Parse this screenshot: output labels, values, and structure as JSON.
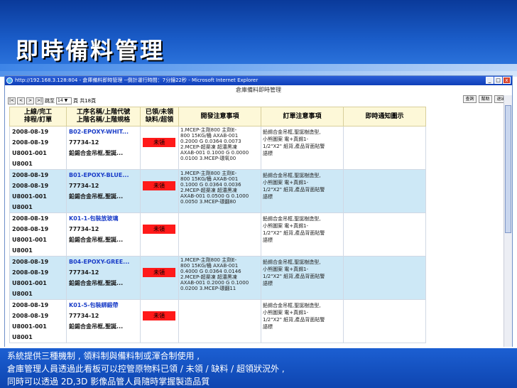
{
  "slide": {
    "title": "即時備料管理",
    "caption": [
      "系統提供三種機制 , 領料制與備料制或渾合制使用 ,",
      "倉庫管理人員透過此看板可以控管原物料已領 / 未領 / 缺料 / 超領狀況外 ,",
      "同時可以透過 2D,3D 影像品管人員隨時掌握製造品質"
    ]
  },
  "window": {
    "title": "http://192.168.3.128:804 - 倉庫備料即時管理 --倒計運行時間：7分鐘22秒 - Microsoft Internet Explorer",
    "page_heading": "倉庫備料即時管理",
    "controls": {
      "minimize": "_",
      "maximize": "□",
      "close": "x"
    }
  },
  "pager": {
    "first": "|<",
    "prev": "<",
    "next": ">",
    "last": ">|",
    "goto_label": "跳至",
    "page_value": "14",
    "dropdown": "▼",
    "total": "頁 共18頁"
  },
  "actions": {
    "query": "查詢",
    "help": "幫助",
    "exit": "退出"
  },
  "table": {
    "headers": {
      "col1": [
        "上線/完工",
        "排程/訂單"
      ],
      "col2": [
        "工序名稱/上階代號",
        "上階名稱/上階規格"
      ],
      "col3": [
        "已領/未領",
        "缺料/超領"
      ],
      "col4": "開發注意事項",
      "col5": "訂單注意事項",
      "col6": "即時通知圖示"
    },
    "rows": [
      {
        "style": "white",
        "col1": [
          "2008-08-19",
          "2008-08-19",
          "U8001-001",
          "U8001"
        ],
        "process": "B02-EPOXY-WHIT...",
        "process_link": true,
        "col2": [
          "77734-12",
          "鉛錫合金吊框,聖誕..."
        ],
        "status": "未領",
        "notes": [
          "1.MCEP-主劑800 主劑E-",
          "800 15KG/桶 AXAB-001",
          "0.2000 G 0.0364 0.0073",
          "2.MCEP-超渠凍 超濃黑凍",
          "AXAB-001 0.1000 G 0.0000",
          "0.0100 3.MCEP-環氧00"
        ],
        "order_notes": [
          "鉛錫合金吊框,聖誕樹造型,",
          "小熊圖案 電+真錫1-",
          "1/2\"X2\" 紙背,產品背面貼警",
          "語標"
        ]
      },
      {
        "style": "blue",
        "col1": [
          "2008-08-19",
          "2008-08-19",
          "U8001-001",
          "U8001"
        ],
        "process": "B01-EPOXY-BLUE...",
        "process_link": true,
        "col2": [
          "77734-12",
          "鉛錫合金吊框,聖誕..."
        ],
        "status": "未領",
        "notes": [
          "1.MCEP-主劑800 主劑E-",
          "800 15KG/桶 AXAB-001",
          "0.1000 G 0.0364 0.0036",
          "2.MCEP-超渠凍 超濃黑凍",
          "AXAB-001 0.0500 G 0.1000",
          "0.0050 3.MCEP-環翻80"
        ],
        "order_notes": [
          "鉛錫合金吊框,聖誕樹造型,",
          "小熊圖案 電+真錫1-",
          "1/2\"X2\" 紙背,產品背面貼警",
          "語標"
        ]
      },
      {
        "style": "white",
        "col1": [
          "2008-08-19",
          "2008-08-19",
          "U8001-001",
          "U8001"
        ],
        "process": "K01-1-包裝放玻璃",
        "process_link": true,
        "col2": [
          "77734-12",
          "鉛錫合金吊框,聖誕..."
        ],
        "status": "未領",
        "notes": [],
        "order_notes": [
          "鉛錫合金吊框,聖誕樹造型,",
          "小熊圖案 電+真錫1-",
          "1/2\"X2\" 紙背,產品背面貼警",
          "語標"
        ]
      },
      {
        "style": "blue",
        "col1": [
          "2008-08-19",
          "2008-08-19",
          "U8001-001",
          "U8001"
        ],
        "process": "B04-EPOXY-GREE...",
        "process_link": true,
        "col2": [
          "77734-12",
          "鉛錫合金吊框,聖誕..."
        ],
        "status": "未領",
        "notes": [
          "1.MCEP-主劑800 主劑E-",
          "800 15KG/桶 AXAB-001",
          "0.4000 G 0.0364 0.0146",
          "2.MCEP-超渠凍 超濃黑凍",
          "AXAB-001 0.2000 G 0.1000",
          "0.0200 3.MCEP-環翻11"
        ],
        "order_notes": [
          "鉛錫合金吊框,聖誕樹造型,",
          "小熊圖案 電+真錫1-",
          "1/2\"X2\" 紙背,產品背面貼警",
          "語標"
        ]
      },
      {
        "style": "white",
        "col1": [
          "2008-08-19",
          "2008-08-19",
          "U8001-001",
          "U8001"
        ],
        "process": "K01-5-包裝綁緞帶",
        "process_link": true,
        "col2": [
          "77734-12",
          "鉛錫合金吊框,聖誕..."
        ],
        "status": "未領",
        "notes": [],
        "order_notes": [
          "鉛錫合金吊框,聖誕樹造型,",
          "小熊圖案 電+真錫1-",
          "1/2\"X2\" 紙背,產品背面貼警",
          "語標"
        ]
      }
    ]
  }
}
